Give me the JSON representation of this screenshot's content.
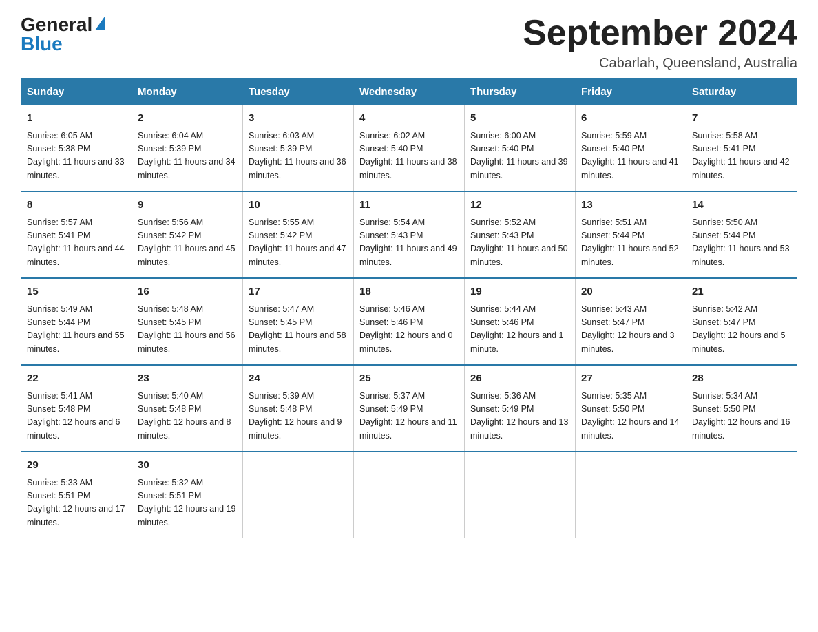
{
  "logo": {
    "general": "General",
    "blue": "Blue"
  },
  "title": {
    "month_year": "September 2024",
    "location": "Cabarlah, Queensland, Australia"
  },
  "weekdays": [
    "Sunday",
    "Monday",
    "Tuesday",
    "Wednesday",
    "Thursday",
    "Friday",
    "Saturday"
  ],
  "weeks": [
    [
      {
        "day": "1",
        "sunrise": "6:05 AM",
        "sunset": "5:38 PM",
        "daylight": "11 hours and 33 minutes."
      },
      {
        "day": "2",
        "sunrise": "6:04 AM",
        "sunset": "5:39 PM",
        "daylight": "11 hours and 34 minutes."
      },
      {
        "day": "3",
        "sunrise": "6:03 AM",
        "sunset": "5:39 PM",
        "daylight": "11 hours and 36 minutes."
      },
      {
        "day": "4",
        "sunrise": "6:02 AM",
        "sunset": "5:40 PM",
        "daylight": "11 hours and 38 minutes."
      },
      {
        "day": "5",
        "sunrise": "6:00 AM",
        "sunset": "5:40 PM",
        "daylight": "11 hours and 39 minutes."
      },
      {
        "day": "6",
        "sunrise": "5:59 AM",
        "sunset": "5:40 PM",
        "daylight": "11 hours and 41 minutes."
      },
      {
        "day": "7",
        "sunrise": "5:58 AM",
        "sunset": "5:41 PM",
        "daylight": "11 hours and 42 minutes."
      }
    ],
    [
      {
        "day": "8",
        "sunrise": "5:57 AM",
        "sunset": "5:41 PM",
        "daylight": "11 hours and 44 minutes."
      },
      {
        "day": "9",
        "sunrise": "5:56 AM",
        "sunset": "5:42 PM",
        "daylight": "11 hours and 45 minutes."
      },
      {
        "day": "10",
        "sunrise": "5:55 AM",
        "sunset": "5:42 PM",
        "daylight": "11 hours and 47 minutes."
      },
      {
        "day": "11",
        "sunrise": "5:54 AM",
        "sunset": "5:43 PM",
        "daylight": "11 hours and 49 minutes."
      },
      {
        "day": "12",
        "sunrise": "5:52 AM",
        "sunset": "5:43 PM",
        "daylight": "11 hours and 50 minutes."
      },
      {
        "day": "13",
        "sunrise": "5:51 AM",
        "sunset": "5:44 PM",
        "daylight": "11 hours and 52 minutes."
      },
      {
        "day": "14",
        "sunrise": "5:50 AM",
        "sunset": "5:44 PM",
        "daylight": "11 hours and 53 minutes."
      }
    ],
    [
      {
        "day": "15",
        "sunrise": "5:49 AM",
        "sunset": "5:44 PM",
        "daylight": "11 hours and 55 minutes."
      },
      {
        "day": "16",
        "sunrise": "5:48 AM",
        "sunset": "5:45 PM",
        "daylight": "11 hours and 56 minutes."
      },
      {
        "day": "17",
        "sunrise": "5:47 AM",
        "sunset": "5:45 PM",
        "daylight": "11 hours and 58 minutes."
      },
      {
        "day": "18",
        "sunrise": "5:46 AM",
        "sunset": "5:46 PM",
        "daylight": "12 hours and 0 minutes."
      },
      {
        "day": "19",
        "sunrise": "5:44 AM",
        "sunset": "5:46 PM",
        "daylight": "12 hours and 1 minute."
      },
      {
        "day": "20",
        "sunrise": "5:43 AM",
        "sunset": "5:47 PM",
        "daylight": "12 hours and 3 minutes."
      },
      {
        "day": "21",
        "sunrise": "5:42 AM",
        "sunset": "5:47 PM",
        "daylight": "12 hours and 5 minutes."
      }
    ],
    [
      {
        "day": "22",
        "sunrise": "5:41 AM",
        "sunset": "5:48 PM",
        "daylight": "12 hours and 6 minutes."
      },
      {
        "day": "23",
        "sunrise": "5:40 AM",
        "sunset": "5:48 PM",
        "daylight": "12 hours and 8 minutes."
      },
      {
        "day": "24",
        "sunrise": "5:39 AM",
        "sunset": "5:48 PM",
        "daylight": "12 hours and 9 minutes."
      },
      {
        "day": "25",
        "sunrise": "5:37 AM",
        "sunset": "5:49 PM",
        "daylight": "12 hours and 11 minutes."
      },
      {
        "day": "26",
        "sunrise": "5:36 AM",
        "sunset": "5:49 PM",
        "daylight": "12 hours and 13 minutes."
      },
      {
        "day": "27",
        "sunrise": "5:35 AM",
        "sunset": "5:50 PM",
        "daylight": "12 hours and 14 minutes."
      },
      {
        "day": "28",
        "sunrise": "5:34 AM",
        "sunset": "5:50 PM",
        "daylight": "12 hours and 16 minutes."
      }
    ],
    [
      {
        "day": "29",
        "sunrise": "5:33 AM",
        "sunset": "5:51 PM",
        "daylight": "12 hours and 17 minutes."
      },
      {
        "day": "30",
        "sunrise": "5:32 AM",
        "sunset": "5:51 PM",
        "daylight": "12 hours and 19 minutes."
      },
      null,
      null,
      null,
      null,
      null
    ]
  ]
}
